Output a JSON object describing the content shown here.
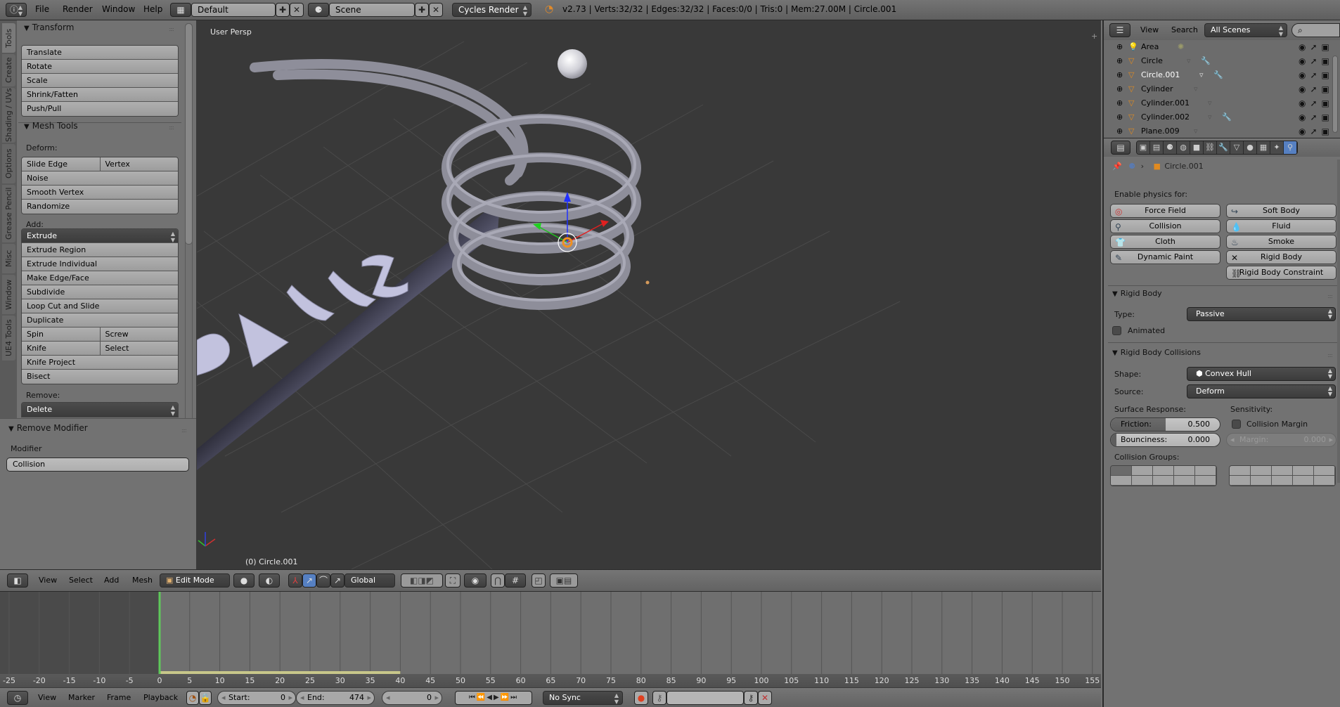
{
  "topbar": {
    "menu": [
      "File",
      "Render",
      "Window",
      "Help"
    ],
    "layout": "Default",
    "scene": "Scene",
    "engine": "Cycles Render",
    "stats": "v2.73 | Verts:32/32 | Edges:32/32 | Faces:0/0 | Tris:0 | Mem:27.00M | Circle.001"
  },
  "shelf": {
    "tabs": [
      "Tools",
      "Create",
      "Shading / UVs",
      "Options",
      "Grease Pencil",
      "Misc",
      "Window",
      "UE4 Tools"
    ],
    "transform": {
      "title": "Transform",
      "buttons": [
        "Translate",
        "Rotate",
        "Scale",
        "Shrink/Fatten",
        "Push/Pull"
      ]
    },
    "mesh_tools": {
      "title": "Mesh Tools",
      "deform_label": "Deform:",
      "slide_edge": "Slide Edge",
      "vertex": "Vertex",
      "deform_buttons": [
        "Noise",
        "Smooth Vertex",
        "Randomize"
      ],
      "add_label": "Add:",
      "extrude": "Extrude",
      "add_buttons": [
        "Extrude Region",
        "Extrude Individual",
        "Make Edge/Face",
        "Subdivide",
        "Loop Cut and Slide",
        "Duplicate"
      ],
      "spin": "Spin",
      "screw": "Screw",
      "knife": "Knife",
      "select": "Select",
      "knife_project": "Knife Project",
      "bisect": "Bisect",
      "remove_label": "Remove:",
      "delete": "Delete"
    },
    "operator": {
      "title": "Remove Modifier",
      "modifier_label": "Modifier",
      "modifier_value": "Collision"
    }
  },
  "viewport": {
    "view_name": "User Persp",
    "object_label": "(0) Circle.001",
    "scene_text": "BALLZ"
  },
  "vp_header": {
    "menus": [
      "View",
      "Select",
      "Add",
      "Mesh"
    ],
    "mode": "Edit Mode",
    "orientation": "Global"
  },
  "timeline": {
    "ticks": [
      -25,
      -20,
      -15,
      -10,
      -5,
      0,
      5,
      10,
      15,
      20,
      25,
      30,
      35,
      40,
      45,
      50,
      55,
      60,
      65,
      70,
      75,
      80,
      85,
      90,
      95,
      100,
      105,
      110,
      115,
      120,
      125,
      130,
      135,
      140,
      145,
      150,
      155
    ],
    "current_frame": 0,
    "menus": [
      "View",
      "Marker",
      "Frame",
      "Playback"
    ],
    "start_label": "Start:",
    "start": "0",
    "end_label": "End:",
    "end": "474",
    "frame": "0",
    "sync": "No Sync",
    "colors": {
      "playhead": "#5fc85a",
      "range": "#c8c78a"
    }
  },
  "outliner": {
    "menus": [
      "View",
      "Search"
    ],
    "filter": "All Scenes",
    "items": [
      {
        "name": "Area",
        "type": "lamp",
        "selected": false,
        "wrench": false
      },
      {
        "name": "Circle",
        "type": "mesh",
        "selected": false,
        "wrench": true
      },
      {
        "name": "Circle.001",
        "type": "mesh",
        "selected": true,
        "wrench": true
      },
      {
        "name": "Cylinder",
        "type": "mesh",
        "selected": false,
        "wrench": false
      },
      {
        "name": "Cylinder.001",
        "type": "mesh",
        "selected": false,
        "wrench": false
      },
      {
        "name": "Cylinder.002",
        "type": "mesh",
        "selected": false,
        "wrench": true
      },
      {
        "name": "Plane.009",
        "type": "mesh",
        "selected": false,
        "wrench": false
      }
    ]
  },
  "properties": {
    "active_tab": "physics",
    "tabs": [
      "render",
      "render-layers",
      "scene",
      "world",
      "object",
      "constraints",
      "modifiers",
      "data",
      "material",
      "texture",
      "particles",
      "physics"
    ],
    "breadcrumb_object": "Circle.001",
    "enable_label": "Enable physics for:",
    "physics_buttons_left": [
      "Force Field",
      "Collision",
      "Cloth",
      "Dynamic Paint"
    ],
    "physics_buttons_right": [
      "Soft Body",
      "Fluid",
      "Smoke",
      "Rigid Body",
      "Rigid Body Constraint"
    ],
    "rigid_body": {
      "title": "Rigid Body",
      "type_label": "Type:",
      "type_value": "Passive",
      "animated_label": "Animated",
      "animated": false
    },
    "collisions": {
      "title": "Rigid Body Collisions",
      "shape_label": "Shape:",
      "shape_value": "Convex Hull",
      "source_label": "Source:",
      "source_value": "Deform",
      "surface_label": "Surface Response:",
      "sensitivity_label": "Sensitivity:",
      "friction_label": "Friction:",
      "friction": "0.500",
      "friction_fraction": 0.5,
      "bounciness_label": "Bounciness:",
      "bounciness": "0.000",
      "margin_check_label": "Collision Margin",
      "margin_label": "Margin:",
      "margin": "0.000",
      "groups_label": "Collision Groups:",
      "groups_active": [
        0
      ]
    }
  }
}
